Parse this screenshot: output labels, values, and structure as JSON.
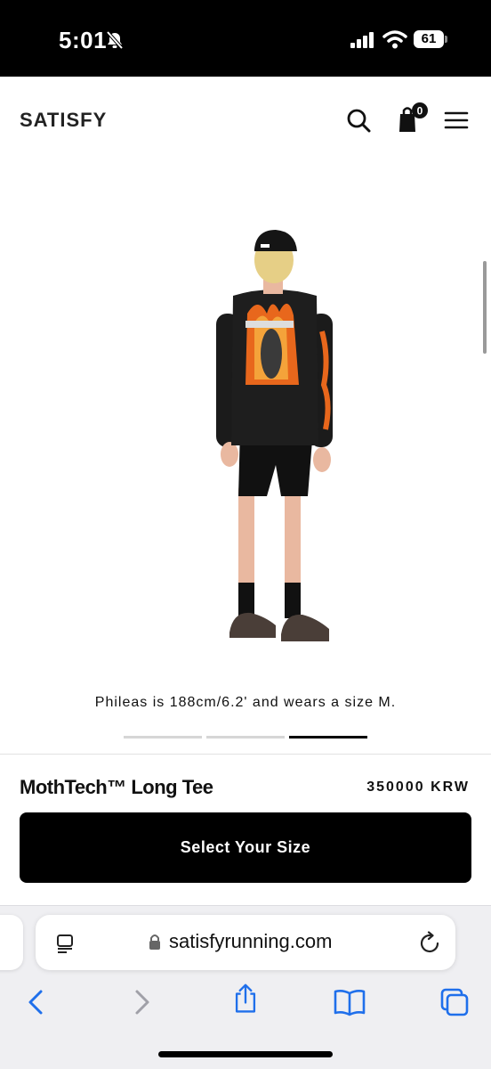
{
  "status_bar": {
    "time": "5:01",
    "battery": "61"
  },
  "header": {
    "logo": "SATISFY",
    "cart_count": "0"
  },
  "product": {
    "model_caption": "Phileas is 188cm/6.2' and wears a size M.",
    "image_count": 3,
    "active_image_index": 2,
    "title": "MothTech™ Long Tee",
    "price": "350000 KRW",
    "select_size_label": "Select Your Size"
  },
  "browser": {
    "url": "satisfyrunning.com"
  },
  "colors": {
    "accent": "#000000",
    "shirt_flame": "#e8671c"
  }
}
